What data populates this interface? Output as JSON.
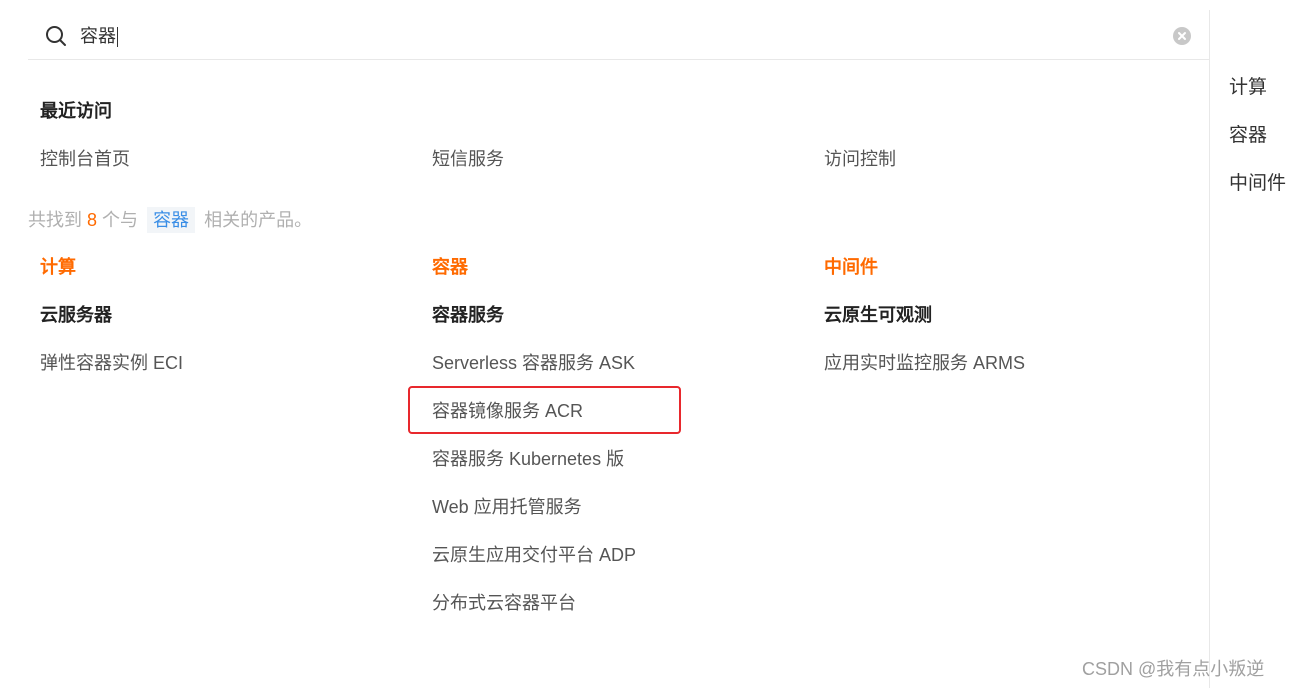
{
  "search": {
    "value": "容器"
  },
  "recent": {
    "title": "最近访问",
    "items": [
      "控制台首页",
      "短信服务",
      "访问控制"
    ]
  },
  "results": {
    "prefix": "共找到",
    "count": "8",
    "middle": "个与",
    "keyword": "容器",
    "suffix": "相关的产品。"
  },
  "columns": [
    {
      "category": "计算",
      "group": "云服务器",
      "items": [
        "弹性容器实例 ECI"
      ]
    },
    {
      "category": "容器",
      "group": "容器服务",
      "items": [
        "Serverless 容器服务 ASK",
        "容器镜像服务 ACR",
        "容器服务 Kubernetes 版",
        "Web 应用托管服务",
        "云原生应用交付平台 ADP",
        "分布式云容器平台"
      ]
    },
    {
      "category": "中间件",
      "group": "云原生可观测",
      "items": [
        "应用实时监控服务 ARMS"
      ]
    }
  ],
  "side_nav": [
    "计算",
    "容器",
    "中间件"
  ],
  "watermark": "CSDN @我有点小叛逆",
  "colors": {
    "accent": "#ff6a00",
    "keyword": "#3a8ee6",
    "highlight": "#e8282d"
  }
}
